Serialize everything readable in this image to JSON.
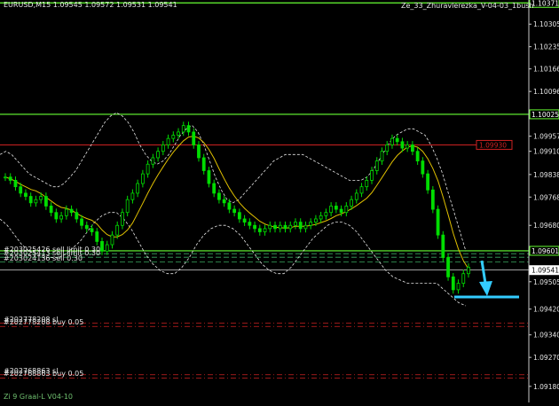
{
  "header": {
    "symbol_line": "EURUSD,M15  1.09545 1.09572 1.09531 1.09541",
    "ea_name": "Ze_33_Zhuravlerezka_V-04-03_1bush"
  },
  "indicator_label": "Zi 9 Graal-L V04-10",
  "colors": {
    "background": "#000000",
    "candle": "#00dd00",
    "level_line": "#66ff33",
    "resistance_line": "#cc2222",
    "band_line": "#e6e6e6",
    "ma_line": "#e0c000",
    "pending_line": "#cc2222",
    "arrow": "#33ccff"
  },
  "price_axis": {
    "ticks": [
      "1.10371",
      "1.10305",
      "1.10235",
      "1.10166",
      "1.10096",
      "1.10025",
      "1.09957",
      "1.09910",
      "1.09838",
      "1.09768",
      "1.09680",
      "1.09541",
      "1.09505",
      "1.09420",
      "1.09340",
      "1.09270",
      "1.09180"
    ],
    "highlight_levels": [
      {
        "price": 1.10371,
        "label": "1.10371",
        "color": "#66ff33"
      },
      {
        "price": 1.10025,
        "label": "1.10025",
        "color": "#66ff33"
      },
      {
        "price": 1.09601,
        "label": "1.09601",
        "color": "#66ff33"
      },
      {
        "price": 1.09541,
        "label": "1.09541",
        "color": "#ffffff"
      }
    ],
    "resistance": {
      "price": 1.0993,
      "label": "1.09930"
    }
  },
  "orders": [
    {
      "text": "#203025426 sell limit 0.30",
      "price": 1.09592
    },
    {
      "text": "#203025413 sell limit 0.30",
      "price": 1.09581
    },
    {
      "text": "#203024136 sell 0.30",
      "price": 1.09566
    },
    {
      "text": "#202778208 sl",
      "price": 1.09376
    },
    {
      "text": "#202778208 buy 0.05",
      "price": 1.09366
    },
    {
      "text": "#202768863 sl",
      "price": 1.09216
    },
    {
      "text": "#202768863 buy 0.05",
      "price": 1.09206
    }
  ],
  "chart_data": {
    "type": "candlestick",
    "ylim": [
      1.0913,
      1.1038
    ],
    "closes": [
      1.0983,
      1.0982,
      1.098,
      1.0978,
      1.0977,
      1.0975,
      1.0976,
      1.0977,
      1.0974,
      1.0972,
      1.097,
      1.0971,
      1.0973,
      1.0972,
      1.097,
      1.0968,
      1.0967,
      1.0966,
      1.0963,
      1.096,
      1.0962,
      1.0965,
      1.0968,
      1.0972,
      1.0976,
      1.0978,
      1.0981,
      1.0984,
      1.0987,
      1.0989,
      1.0991,
      1.0993,
      1.0995,
      1.0996,
      1.0997,
      1.0999,
      1.0997,
      1.0993,
      1.0989,
      1.0985,
      1.0981,
      1.0978,
      1.0976,
      1.0975,
      1.0973,
      1.0972,
      1.097,
      1.0969,
      1.0968,
      1.0967,
      1.0966,
      1.0967,
      1.0968,
      1.0967,
      1.0968,
      1.0967,
      1.0968,
      1.0969,
      1.0967,
      1.0968,
      1.0969,
      1.097,
      1.0971,
      1.0972,
      1.0974,
      1.0973,
      1.0972,
      1.0974,
      1.0976,
      1.0978,
      1.098,
      1.0982,
      1.0985,
      1.0988,
      1.0991,
      1.0993,
      1.0995,
      1.0994,
      1.0992,
      1.0993,
      1.0991,
      1.0988,
      1.0984,
      1.0979,
      1.0973,
      1.0965,
      1.0958,
      1.0952,
      1.0948,
      1.095,
      1.0953,
      1.0955
    ],
    "upper_band": [
      1.099,
      1.0991,
      1.099,
      1.0988,
      1.0986,
      1.0984,
      1.0983,
      1.0982,
      1.0981,
      1.098,
      1.098,
      1.0981,
      1.0983,
      1.0985,
      1.0988,
      1.0991,
      1.0994,
      1.0997,
      1.1,
      1.1002,
      1.1003,
      1.1002,
      1.1,
      1.0997,
      1.0993,
      1.099,
      1.0988,
      1.0987,
      1.0988,
      1.099,
      1.0993,
      1.0996,
      1.0998,
      1.0999,
      1.0997,
      1.0993,
      1.0988,
      1.0983,
      1.0979,
      1.0976,
      1.0975,
      1.0976,
      1.0978,
      1.098,
      1.0982,
      1.0984,
      1.0986,
      1.0988,
      1.0989,
      1.099,
      1.099,
      1.099,
      1.099,
      1.0989,
      1.0988,
      1.0987,
      1.0986,
      1.0985,
      1.0984,
      1.0983,
      1.0982,
      1.0982,
      1.0982,
      1.0983,
      1.0985,
      1.0988,
      1.0991,
      1.0994,
      1.0996,
      1.0997,
      1.0998,
      1.0998,
      1.0997,
      1.0996,
      1.0993,
      1.0989,
      1.0984,
      1.0978,
      1.0972,
      1.0966,
      1.096
    ],
    "lower_band": [
      1.097,
      1.0968,
      1.0965,
      1.0962,
      1.096,
      1.0959,
      1.0958,
      1.0958,
      1.0958,
      1.0959,
      1.0961,
      1.0963,
      1.0966,
      1.0969,
      1.0971,
      1.0972,
      1.0972,
      1.097,
      1.0967,
      1.0963,
      1.0959,
      1.0956,
      1.0954,
      1.0953,
      1.0953,
      1.0955,
      1.0958,
      1.0962,
      1.0965,
      1.0967,
      1.0968,
      1.0968,
      1.0967,
      1.0965,
      1.0962,
      1.0959,
      1.0956,
      1.0954,
      1.0953,
      1.0953,
      1.0955,
      1.0958,
      1.0961,
      1.0964,
      1.0966,
      1.0968,
      1.0969,
      1.0969,
      1.0968,
      1.0966,
      1.0963,
      1.096,
      1.0957,
      1.0954,
      1.0952,
      1.0951,
      1.095,
      1.095,
      1.095,
      1.095,
      1.095,
      1.0948,
      1.0946,
      1.0944,
      1.0943
    ]
  }
}
